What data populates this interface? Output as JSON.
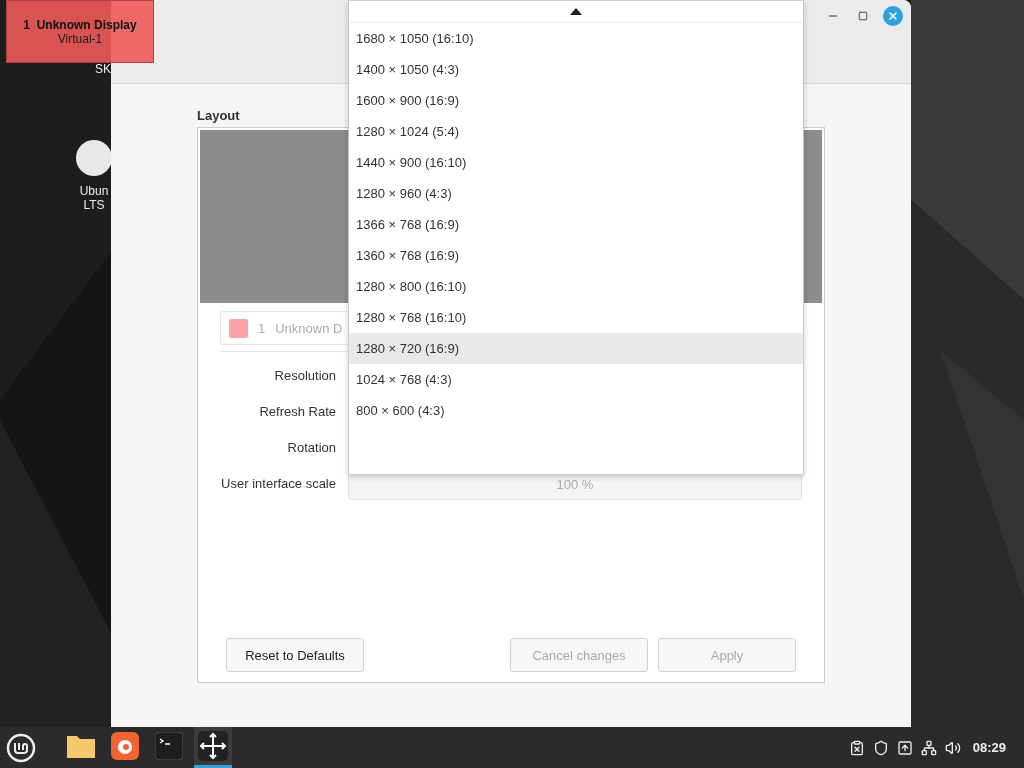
{
  "desktop": {
    "icons": [
      {
        "lines": [
          "SK"
        ]
      },
      {
        "lines": [
          "Ubun",
          "LTS"
        ]
      }
    ]
  },
  "display_label": {
    "title": "1  Unknown Display",
    "output": "Virtual-1"
  },
  "window": {
    "section_title": "Layout",
    "display_row": {
      "number": "1",
      "name": "Unknown D"
    },
    "settings": [
      {
        "label": "Resolution"
      },
      {
        "label": "Refresh Rate"
      },
      {
        "label": "Rotation"
      },
      {
        "label": "User interface scale",
        "value": "100 %"
      }
    ],
    "buttons": [
      {
        "label": "Reset to Defaults",
        "disabled": false
      },
      {
        "label": "Cancel changes",
        "disabled": true
      },
      {
        "label": "Apply",
        "disabled": true
      }
    ]
  },
  "dropdown": {
    "items": [
      {
        "label": "1680 × 1050 (16:10)",
        "selected": false
      },
      {
        "label": "1400 × 1050 (4:3)",
        "selected": false
      },
      {
        "label": "1600 × 900 (16:9)",
        "selected": false
      },
      {
        "label": "1280 × 1024 (5:4)",
        "selected": false
      },
      {
        "label": "1440 × 900 (16:10)",
        "selected": false
      },
      {
        "label": "1280 × 960 (4:3)",
        "selected": false
      },
      {
        "label": "1366 × 768 (16:9)",
        "selected": false
      },
      {
        "label": "1360 × 768 (16:9)",
        "selected": false
      },
      {
        "label": "1280 × 800 (16:10)",
        "selected": false
      },
      {
        "label": "1280 × 768 (16:10)",
        "selected": false
      },
      {
        "label": "1280 × 720 (16:9)",
        "selected": true
      },
      {
        "label": "1024 × 768 (4:3)",
        "selected": false
      },
      {
        "label": "800 × 600 (4:3)",
        "selected": false
      }
    ]
  },
  "taskbar": {
    "apps": [
      {
        "kind": "folder",
        "active": false
      },
      {
        "kind": "browser",
        "active": false
      },
      {
        "kind": "terminal",
        "active": false
      },
      {
        "kind": "display",
        "active": true
      }
    ],
    "tray": [
      {
        "kind": "clipboard"
      },
      {
        "kind": "shield"
      },
      {
        "kind": "eject"
      },
      {
        "kind": "network"
      },
      {
        "kind": "volume"
      }
    ],
    "clock": "08:29"
  }
}
